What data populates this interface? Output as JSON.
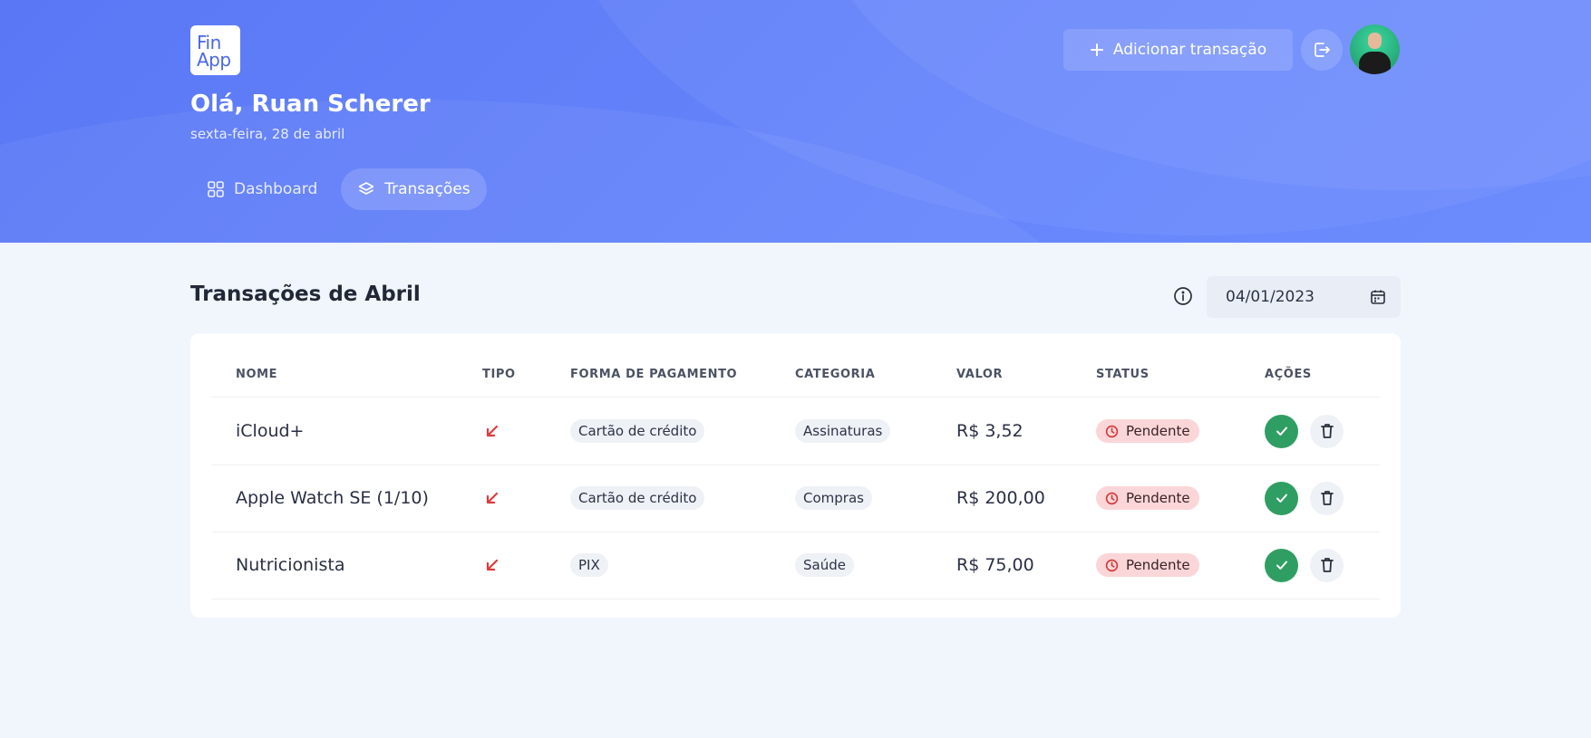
{
  "logo": {
    "line1": "Fin",
    "line2": "App"
  },
  "header": {
    "greeting": "Olá, Ruan Scherer",
    "date": "sexta-feira, 28 de abril",
    "add_button_label": "Adicionar transação",
    "nav": [
      {
        "label": "Dashboard",
        "icon": "grid-icon",
        "active": false
      },
      {
        "label": "Transações",
        "icon": "layers-icon",
        "active": true
      }
    ]
  },
  "main": {
    "title": "Transações de Abril",
    "date_filter": {
      "value": "04/01/2023"
    },
    "table": {
      "columns": [
        "NOME",
        "TIPO",
        "FORMA DE PAGAMENTO",
        "CATEGORIA",
        "VALOR",
        "STATUS",
        "AÇÕES"
      ],
      "rows": [
        {
          "name": "iCloud+",
          "type": "expense",
          "payment": "Cartão de crédito",
          "category": "Assinaturas",
          "value": "R$ 3,52",
          "status": "Pendente"
        },
        {
          "name": "Apple Watch SE (1/10)",
          "type": "expense",
          "payment": "Cartão de crédito",
          "category": "Compras",
          "value": "R$ 200,00",
          "status": "Pendente"
        },
        {
          "name": "Nutricionista",
          "type": "expense",
          "payment": "PIX",
          "category": "Saúde",
          "value": "R$ 75,00",
          "status": "Pendente"
        }
      ]
    }
  },
  "colors": {
    "header_bg": "#5f7ef8",
    "expense_arrow": "#e03b3b",
    "status_pending_bg": "#fbd6d8",
    "confirm_green": "#2f9e62"
  }
}
